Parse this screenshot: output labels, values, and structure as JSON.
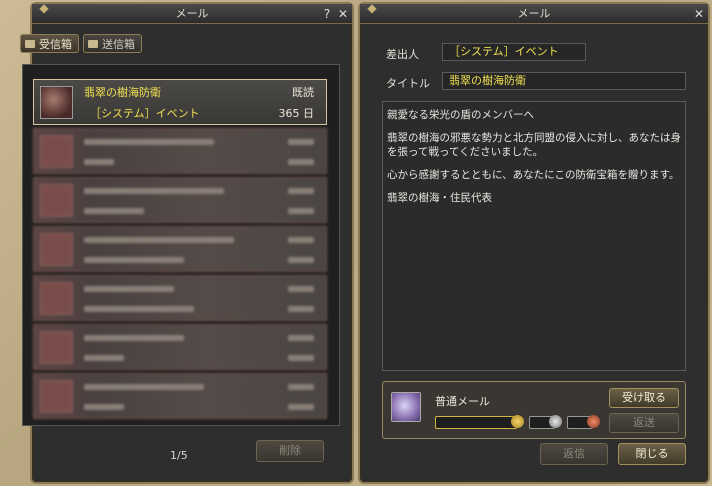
{
  "left_window": {
    "title": "メール",
    "help_label": "?",
    "close_label": "✕",
    "tabs": [
      {
        "label": "受信箱",
        "active": true
      },
      {
        "label": "送信箱",
        "active": false
      }
    ],
    "mails": [
      {
        "subject": "翡翠の樹海防衛",
        "sender": "［システム］イベント",
        "status": "既読",
        "days": "365 日"
      }
    ],
    "pager": "1/5",
    "delete_label": "削除"
  },
  "right_window": {
    "title": "メール",
    "close_label": "✕",
    "sender_label": "差出人",
    "sender_value": "［システム］イベント",
    "title_label": "タイトル",
    "title_value": "翡翠の樹海防衛",
    "body": [
      "親愛なる栄光の盾のメンバーへ",
      "翡翠の樹海の邪悪な勢力と北方同盟の侵入に対し、あなたは身を張って戦ってくださいました。",
      "心から感謝するとともに、あなたにこの防衛宝箱を贈ります。",
      "翡翠の樹海・住民代表"
    ],
    "attachment": {
      "type_label": "普通メール",
      "receive_label": "受け取る",
      "return_small_label": "返送"
    },
    "reply_label": "返信",
    "close_button_label": "閉じる"
  },
  "colors": {
    "accent_text": "#f0e050",
    "frame": "#8a7a55"
  }
}
